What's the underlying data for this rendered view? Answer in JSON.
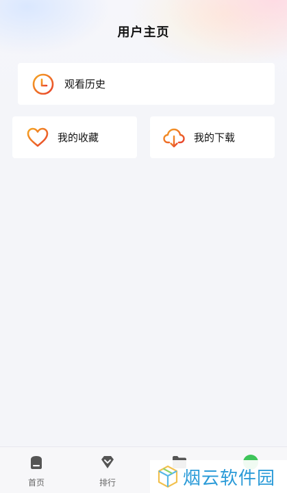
{
  "header": {
    "title": "用户主页"
  },
  "cards": {
    "history": {
      "label": "观看历史",
      "icon": "clock-icon"
    },
    "favorites": {
      "label": "我的收藏",
      "icon": "heart-icon"
    },
    "downloads": {
      "label": "我的下载",
      "icon": "cloud-download-icon"
    }
  },
  "tabbar": {
    "items": [
      {
        "label": "首页",
        "icon": "home-icon"
      },
      {
        "label": "排行",
        "icon": "rank-icon"
      },
      {
        "label": "",
        "icon": "folder-icon"
      },
      {
        "label": "",
        "icon": "profile-icon"
      }
    ]
  },
  "watermark": {
    "text": "烟云软件园"
  },
  "colors": {
    "accent_gradient_start": "#f5a623",
    "accent_gradient_end": "#e8412c",
    "background": "#f4f5f9",
    "tab_icon": "#555555",
    "active_tab": "#3ec45a",
    "watermark_text": "#2b9bd8"
  }
}
